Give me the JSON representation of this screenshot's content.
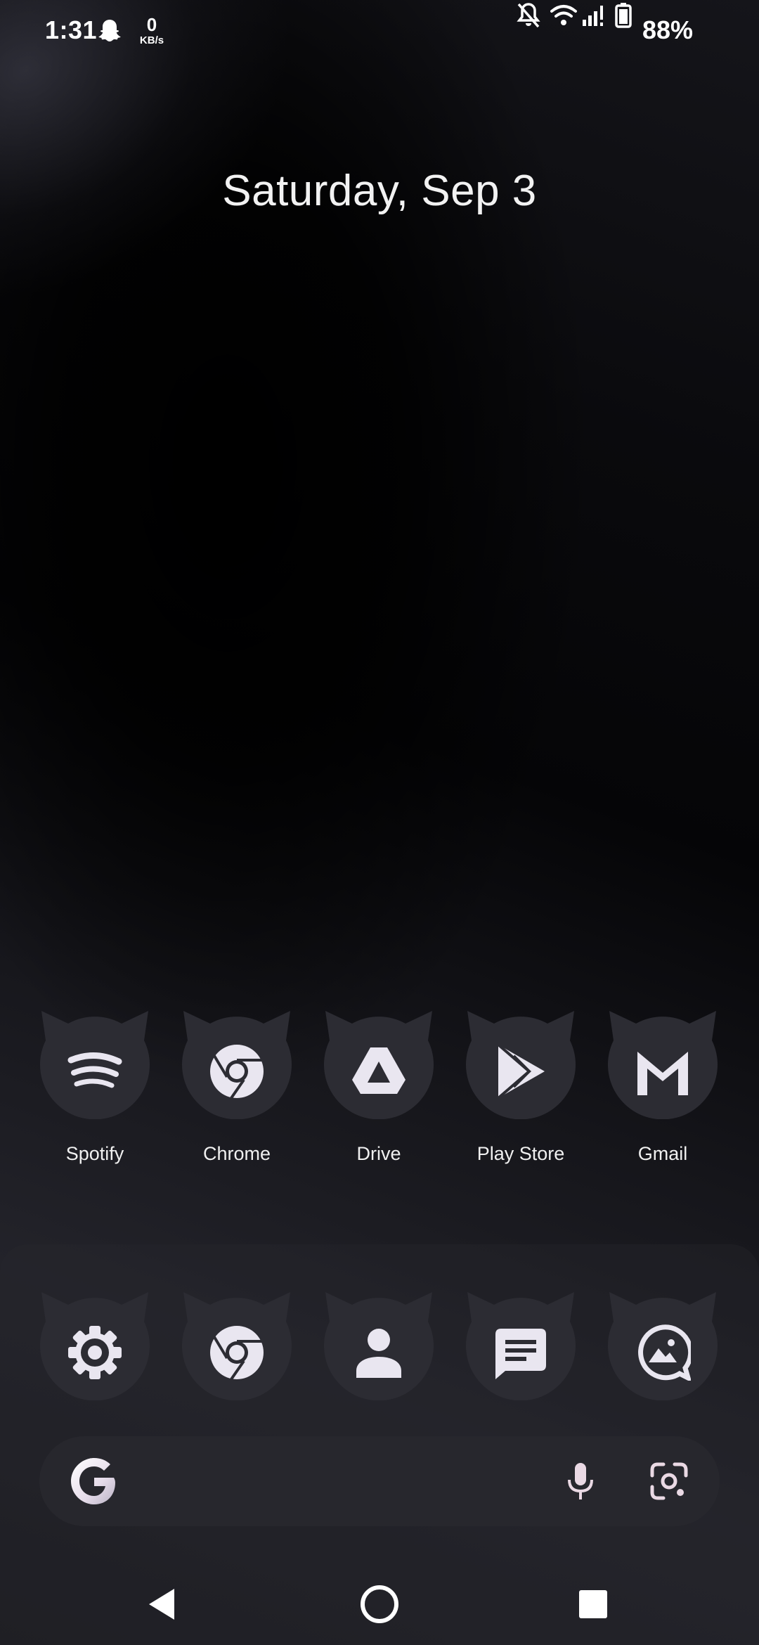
{
  "status_bar": {
    "time": "1:31",
    "net_speed_value": "0",
    "net_speed_unit": "KB/s",
    "battery_percent": "88%",
    "icons": [
      "snapchat-icon",
      "notifications-off-icon",
      "wifi-icon",
      "cell-signal-icon",
      "battery-icon"
    ]
  },
  "home": {
    "date": "Saturday, Sep 3"
  },
  "apps": [
    {
      "label": "Spotify",
      "icon": "spotify-icon"
    },
    {
      "label": "Chrome",
      "icon": "chrome-icon"
    },
    {
      "label": "Drive",
      "icon": "drive-icon"
    },
    {
      "label": "Play Store",
      "icon": "play-store-icon"
    },
    {
      "label": "Gmail",
      "icon": "gmail-icon"
    }
  ],
  "dock": [
    {
      "icon": "settings-icon"
    },
    {
      "icon": "chrome-icon"
    },
    {
      "icon": "contacts-icon"
    },
    {
      "icon": "messages-icon"
    },
    {
      "icon": "gallery-icon"
    }
  ],
  "search": {
    "logo": "google-g-icon",
    "icons": [
      "microphone-icon",
      "lens-icon"
    ]
  },
  "nav": [
    "back-button",
    "home-button",
    "recents-button"
  ],
  "colors": {
    "icon_bg": "#2c2c33",
    "glyph": "#e9e6f0",
    "search_bg": "#27272d"
  }
}
